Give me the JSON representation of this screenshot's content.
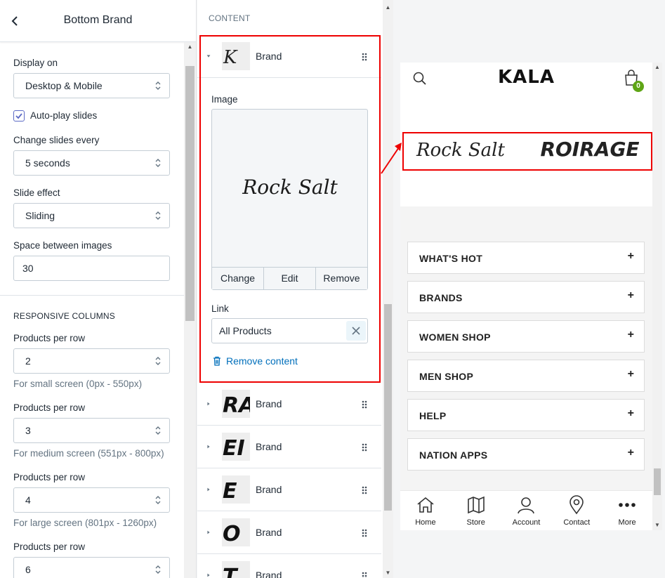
{
  "left_panel": {
    "title": "Bottom Brand",
    "display_on": {
      "label": "Display on",
      "value": "Desktop & Mobile"
    },
    "autoplay": {
      "label": "Auto-play slides",
      "checked": true
    },
    "change_slides": {
      "label": "Change slides every",
      "value": "5 seconds"
    },
    "slide_effect": {
      "label": "Slide effect",
      "value": "Sliding"
    },
    "space_between": {
      "label": "Space between images",
      "value": "30"
    },
    "responsive_heading": "RESPONSIVE COLUMNS",
    "columns": [
      {
        "label": "Products per row",
        "value": "2",
        "help": "For small screen (0px - 550px)"
      },
      {
        "label": "Products per row",
        "value": "3",
        "help": "For medium screen (551px - 800px)"
      },
      {
        "label": "Products per row",
        "value": "4",
        "help": "For large screen (801px - 1260px)"
      },
      {
        "label": "Products per row",
        "value": "6",
        "help": ""
      }
    ]
  },
  "middle_panel": {
    "heading": "CONTENT",
    "expanded_item": {
      "label": "Brand",
      "image_label": "Image",
      "image_text": "Rock Salt",
      "actions": {
        "change": "Change",
        "edit": "Edit",
        "remove": "Remove"
      },
      "link_label": "Link",
      "link_value": "All Products",
      "remove_content": "Remove content"
    },
    "items": [
      {
        "label": "Brand",
        "thumb": "RA"
      },
      {
        "label": "Brand",
        "thumb": "EI"
      },
      {
        "label": "Brand",
        "thumb": "E"
      },
      {
        "label": "Brand",
        "thumb": "O"
      },
      {
        "label": "Brand",
        "thumb": "T"
      }
    ],
    "first_thumb": "K"
  },
  "preview": {
    "store_name": "KALA",
    "cart_count": "0",
    "brands": [
      "Rock Salt",
      "ROIRAGE"
    ],
    "menu": [
      "WHAT'S HOT",
      "BRANDS",
      "WOMEN SHOP",
      "MEN SHOP",
      "HELP",
      "NATION APPS"
    ],
    "plus": "+",
    "nav": [
      {
        "label": "Home",
        "icon": "home-icon"
      },
      {
        "label": "Store",
        "icon": "map-icon"
      },
      {
        "label": "Account",
        "icon": "user-icon"
      },
      {
        "label": "Contact",
        "icon": "location-pin-icon"
      },
      {
        "label": "More",
        "icon": "more-dots-icon"
      }
    ],
    "accent_colors": {
      "highlight": "#ee0000",
      "badge": "#5fa516",
      "link": "#006fbb"
    }
  }
}
